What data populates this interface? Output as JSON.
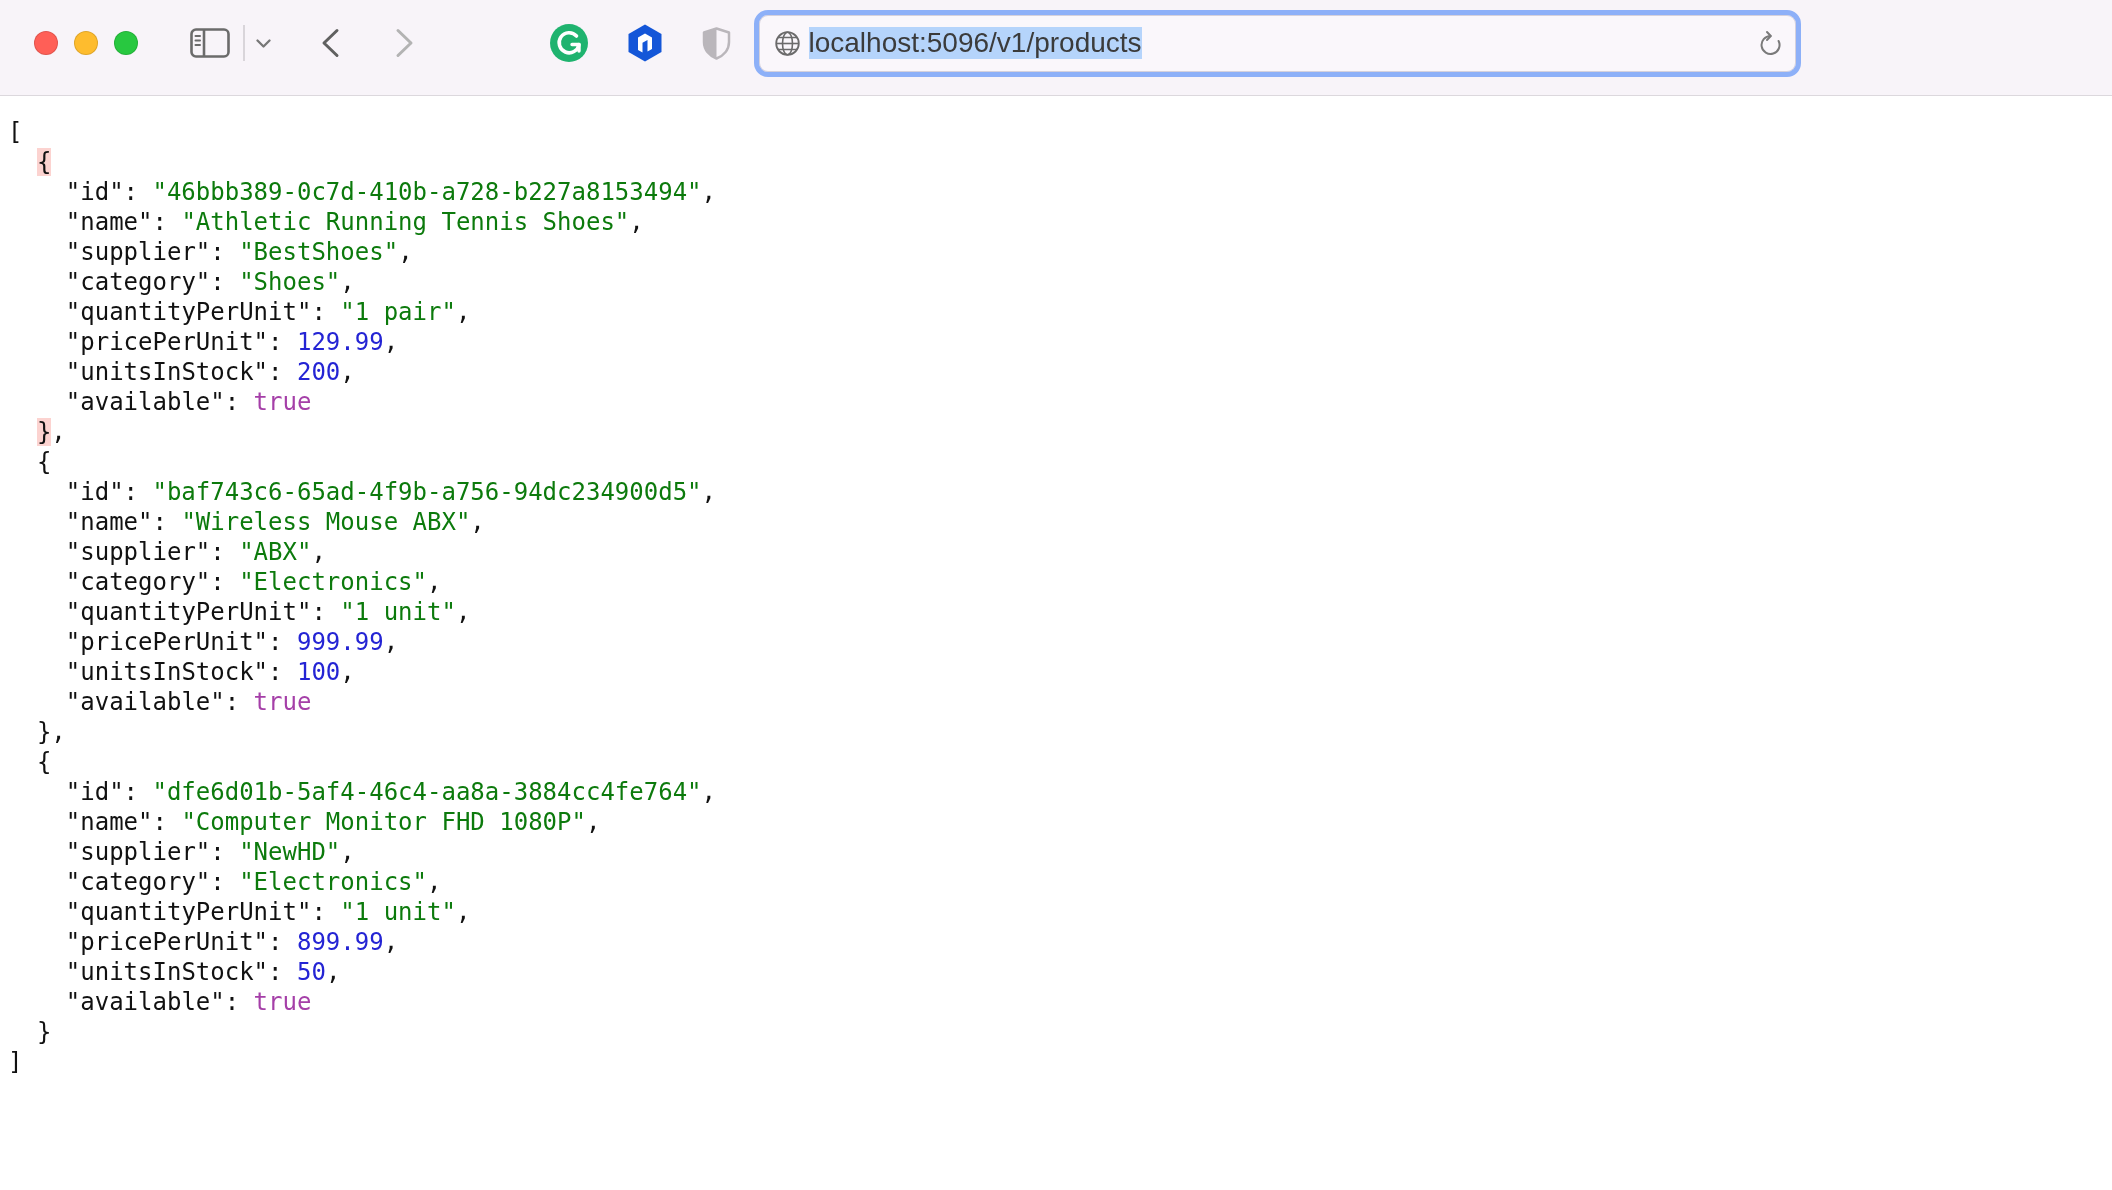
{
  "window_controls": [
    {
      "kind": "close"
    },
    {
      "kind": "minimize"
    },
    {
      "kind": "zoom"
    }
  ],
  "navigation": [
    {
      "kind": "back",
      "disabled": false
    },
    {
      "kind": "forward",
      "disabled": true
    }
  ],
  "extensions": [
    {
      "kind": "circle-arrow"
    },
    {
      "kind": "hexagon"
    },
    {
      "kind": "shield"
    }
  ],
  "address_bar": {
    "url": "localhost:5096/v1/products",
    "focused": true,
    "text_selected": true
  },
  "document": {
    "open": "[",
    "close": "]",
    "objects": [
      {
        "open": "{",
        "close": "}",
        "comma": ",",
        "braces_highlighted": true,
        "fields": [
          {
            "key": "\"id\":",
            "value": "\"46bbb389-0c7d-410b-a728-b227a8153494\"",
            "kind": "string",
            "comma": ","
          },
          {
            "key": "\"name\":",
            "value": "\"Athletic Running Tennis Shoes\"",
            "kind": "string",
            "comma": ","
          },
          {
            "key": "\"supplier\":",
            "value": "\"BestShoes\"",
            "kind": "string",
            "comma": ","
          },
          {
            "key": "\"category\":",
            "value": "\"Shoes\"",
            "kind": "string",
            "comma": ","
          },
          {
            "key": "\"quantityPerUnit\":",
            "value": "\"1 pair\"",
            "kind": "string",
            "comma": ","
          },
          {
            "key": "\"pricePerUnit\":",
            "value": "129.99",
            "kind": "number",
            "comma": ","
          },
          {
            "key": "\"unitsInStock\":",
            "value": "200",
            "kind": "number",
            "comma": ","
          },
          {
            "key": "\"available\":",
            "value": "true",
            "kind": "boolean"
          }
        ]
      },
      {
        "open": "{",
        "close": "}",
        "comma": ",",
        "braces_highlighted": false,
        "fields": [
          {
            "key": "\"id\":",
            "value": "\"baf743c6-65ad-4f9b-a756-94dc234900d5\"",
            "kind": "string",
            "comma": ","
          },
          {
            "key": "\"name\":",
            "value": "\"Wireless Mouse ABX\"",
            "kind": "string",
            "comma": ","
          },
          {
            "key": "\"supplier\":",
            "value": "\"ABX\"",
            "kind": "string",
            "comma": ","
          },
          {
            "key": "\"category\":",
            "value": "\"Electronics\"",
            "kind": "string",
            "comma": ","
          },
          {
            "key": "\"quantityPerUnit\":",
            "value": "\"1 unit\"",
            "kind": "string",
            "comma": ","
          },
          {
            "key": "\"pricePerUnit\":",
            "value": "999.99",
            "kind": "number",
            "comma": ","
          },
          {
            "key": "\"unitsInStock\":",
            "value": "100",
            "kind": "number",
            "comma": ","
          },
          {
            "key": "\"available\":",
            "value": "true",
            "kind": "boolean"
          }
        ]
      },
      {
        "open": "{",
        "close": "}",
        "braces_highlighted": false,
        "fields": [
          {
            "key": "\"id\":",
            "value": "\"dfe6d01b-5af4-46c4-aa8a-3884cc4fe764\"",
            "kind": "string",
            "comma": ","
          },
          {
            "key": "\"name\":",
            "value": "\"Computer Monitor FHD 1080P\"",
            "kind": "string",
            "comma": ","
          },
          {
            "key": "\"supplier\":",
            "value": "\"NewHD\"",
            "kind": "string",
            "comma": ","
          },
          {
            "key": "\"category\":",
            "value": "\"Electronics\"",
            "kind": "string",
            "comma": ","
          },
          {
            "key": "\"quantityPerUnit\":",
            "value": "\"1 unit\"",
            "kind": "string",
            "comma": ","
          },
          {
            "key": "\"pricePerUnit\":",
            "value": "899.99",
            "kind": "number",
            "comma": ","
          },
          {
            "key": "\"unitsInStock\":",
            "value": "50",
            "kind": "number",
            "comma": ","
          },
          {
            "key": "\"available\":",
            "value": "true",
            "kind": "boolean"
          }
        ]
      }
    ]
  }
}
